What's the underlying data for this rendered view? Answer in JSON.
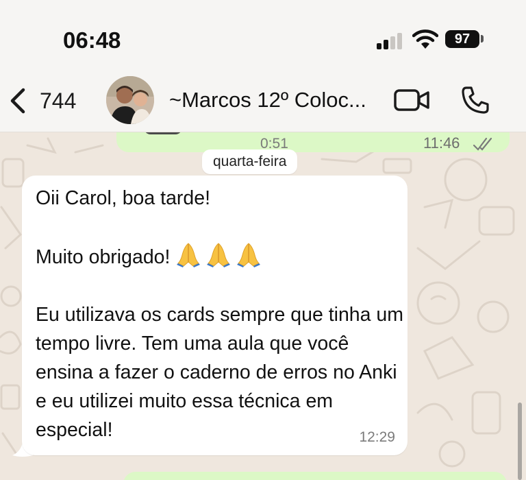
{
  "status_bar": {
    "time": "06:48",
    "battery": "97",
    "icons": [
      "signal-icon",
      "wifi-icon",
      "battery-icon"
    ]
  },
  "header": {
    "back_count": "744",
    "contact_name": "~Marcos 12º Coloc...",
    "icons": [
      "back-chevron-icon",
      "video-call-icon",
      "phone-call-icon"
    ]
  },
  "chat": {
    "previous_message": {
      "duration": "0:51",
      "time": "11:46"
    },
    "date_separator": "quarta-feira",
    "message": {
      "line1": "Oii Carol, boa tarde!",
      "line2": "Muito obrigado!",
      "emojis": [
        "folded-hands",
        "folded-hands",
        "folded-hands"
      ],
      "paragraph": "Eu utilizava os cards sempre que tinha um tempo livre. Tem uma aula que você ensina a fazer o caderno de erros no Anki e eu utilizei muito essa técnica em especial!",
      "time": "12:29"
    }
  },
  "colors": {
    "header_bg": "#f6f5f3",
    "chat_bg": "#efe7de",
    "incoming_bubble": "#ffffff",
    "outgoing_bubble": "#dcf8c6"
  }
}
